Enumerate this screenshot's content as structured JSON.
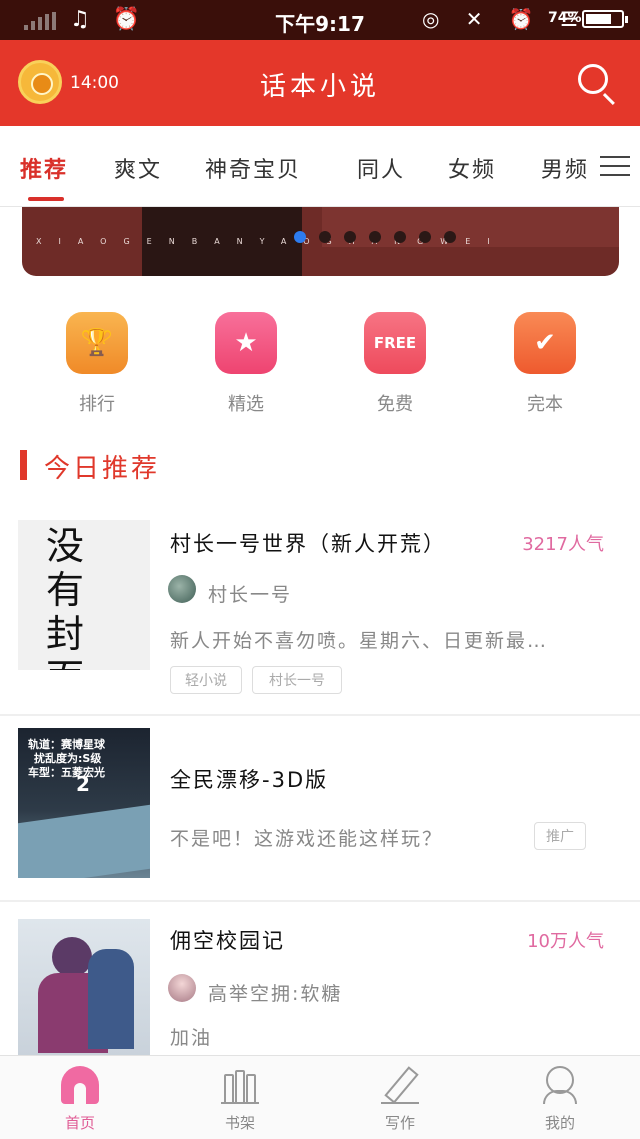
{
  "status_bar": {
    "time": "下午9:17",
    "battery": "74%",
    "battery_level": 0.74,
    "left_icons": "♫ ⏰",
    "right_icons": "◎ ✕ ⏰ ☰"
  },
  "header": {
    "time": "14:00",
    "title": "话本小说"
  },
  "tabs": [
    {
      "label": "推荐",
      "active": true
    },
    {
      "label": "爽文"
    },
    {
      "label": "神奇宝贝"
    },
    {
      "label": "同人"
    },
    {
      "label": "女频"
    },
    {
      "label": "男频"
    }
  ],
  "banner": {
    "caption": "XIAOGENBANYAOSHANGWEI",
    "dot_count": 7,
    "active_dot": 0
  },
  "quick_links": [
    {
      "label": "排行",
      "icon": "trophy-icon",
      "color": "#f5a23a"
    },
    {
      "label": "精选",
      "icon": "star-icon",
      "color": "#f2557f"
    },
    {
      "label": "免费",
      "icon": "free-icon",
      "color": "#f2566e",
      "icon_text": "FREE"
    },
    {
      "label": "完本",
      "icon": "check-icon",
      "color": "#f26a3e"
    }
  ],
  "section": {
    "title": "今日推荐"
  },
  "books": [
    {
      "title": "村长一号世界（新人开荒）",
      "popularity": "3217人气",
      "author": "村长一号",
      "description": "新人开始不喜勿喷。星期六、日更新最…",
      "tags": [
        "轻小说",
        "村长一号"
      ],
      "cover_text": "没有封面"
    },
    {
      "title": "全民漂移-3D版",
      "description": "不是吧！这游戏还能这样玩？",
      "badge": "推广",
      "cover_lines": [
        "轨道：赛博星球",
        "扰乱度为:S级",
        "车型：五菱宏光",
        "2"
      ]
    },
    {
      "title": "佣空校园记",
      "popularity": "10万人气",
      "author": "高举空拥:软糖",
      "description": "加油"
    }
  ],
  "bottom_nav": [
    {
      "label": "首页",
      "icon": "home-icon",
      "active": true
    },
    {
      "label": "书架",
      "icon": "bookshelf-icon"
    },
    {
      "label": "写作",
      "icon": "pencil-icon"
    },
    {
      "label": "我的",
      "icon": "profile-icon"
    }
  ],
  "colors": {
    "brand": "#e4372a",
    "accent": "#e0382b",
    "pink": "#e06aa0"
  }
}
